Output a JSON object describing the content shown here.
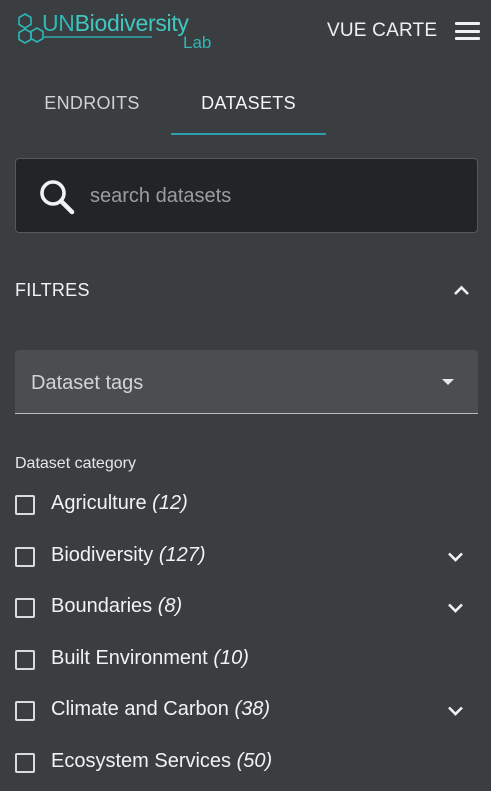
{
  "header": {
    "logo": {
      "un": "UN",
      "biodiversity": "Biodiversity",
      "lab": "Lab"
    },
    "map_view_label": "VUE CARTE",
    "menu_icon": "hamburger-menu-icon"
  },
  "tabs": [
    {
      "label": "ENDROITS",
      "active": false
    },
    {
      "label": "DATASETS",
      "active": true
    }
  ],
  "accent_color": "#2ea0b0",
  "search": {
    "placeholder": "search datasets",
    "value": "",
    "icon": "search-icon"
  },
  "filters": {
    "title": "FILTRES",
    "expanded": true,
    "tags_select": {
      "label": "Dataset tags"
    },
    "category_title": "Dataset category",
    "categories": [
      {
        "name": "Agriculture",
        "count": "(12)",
        "expandable": false,
        "checked": false
      },
      {
        "name": "Biodiversity",
        "count": "(127)",
        "expandable": true,
        "checked": false
      },
      {
        "name": "Boundaries",
        "count": "(8)",
        "expandable": true,
        "checked": false
      },
      {
        "name": "Built Environment",
        "count": "(10)",
        "expandable": false,
        "checked": false
      },
      {
        "name": "Climate and Carbon",
        "count": "(38)",
        "expandable": true,
        "checked": false
      },
      {
        "name": "Ecosystem Services",
        "count": "(50)",
        "expandable": false,
        "checked": false
      }
    ]
  }
}
